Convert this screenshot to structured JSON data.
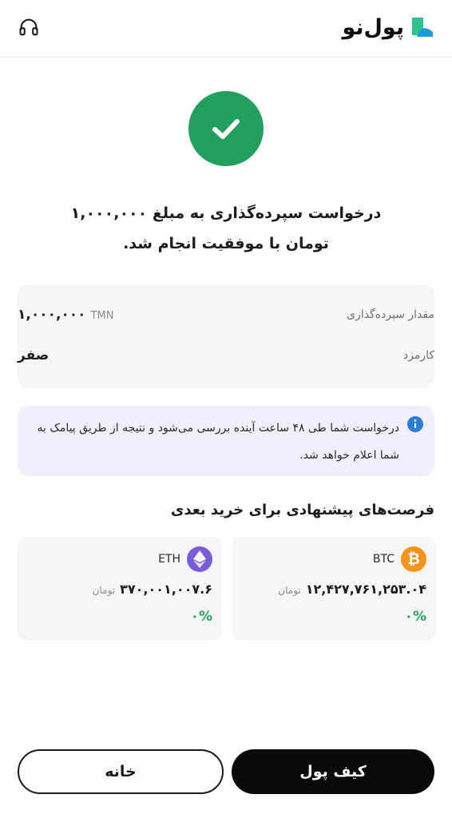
{
  "header": {
    "brand_name": "پول‌نو",
    "support_icon": "headset-icon",
    "brand_icon": "brand-logo-icon",
    "brand_colors": [
      "#1e9bd7",
      "#2bc48a"
    ]
  },
  "status": {
    "icon": "check-icon",
    "color": "#20a05a",
    "message_line1": "درخواست سپرده‌گذاری به مبلغ ۱,۰۰۰,۰۰۰",
    "message_line2": "تومان با موفقیت انجام شد."
  },
  "details": {
    "deposit_label": "مقدار سپرده‌گذاری",
    "deposit_value": "۱,۰۰۰,۰۰۰",
    "deposit_unit": "TMN",
    "fee_label": "کارمزد",
    "fee_value": "صفر"
  },
  "info": {
    "icon": "info-icon",
    "text": "درخواست شما طی ۴۸ ساعت آینده بررسی می‌شود و نتیجه از طریق پیامک به شما اعلام خواهد شد."
  },
  "suggestions": {
    "title": "فرصت‌های پیشنهادی برای خرید بعدی",
    "items": [
      {
        "symbol": "BTC",
        "icon": "bitcoin-icon",
        "color": "#f7931a",
        "price": "۱۲,۴۲۷,۷۶۱,۲۵۳.۰۴",
        "unit": "تومان",
        "change": "۰%"
      },
      {
        "symbol": "ETH",
        "icon": "ethereum-icon",
        "color": "#7b5bd6",
        "price": "۳۷۰,۰۰۱,۰۰۷.۶",
        "unit": "تومان",
        "change": "۰%"
      }
    ]
  },
  "actions": {
    "wallet_label": "کیف پول",
    "home_label": "خانه"
  }
}
